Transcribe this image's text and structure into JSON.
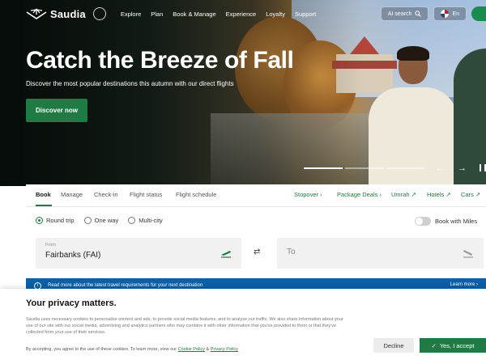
{
  "nav": {
    "logo_text": "Saudia",
    "menu": [
      "Explore",
      "Plan",
      "Book & Manage",
      "Experience",
      "Loyalty",
      "Support"
    ],
    "search_label": "AI search",
    "language": "En"
  },
  "hero": {
    "title": "Catch the Breeze of Fall",
    "subtitle": "Discover the most popular destinations this autumn with our direct flights",
    "cta": "Discover now",
    "slide_count": 3,
    "active_slide": 1
  },
  "booking": {
    "tabs": [
      "Book",
      "Manage",
      "Check-in",
      "Flight status",
      "Flight schedule"
    ],
    "active_tab": "Book",
    "quick_links": [
      "Stopover",
      "Package Deals",
      "Umrah",
      "Hotels",
      "Cars"
    ],
    "trip_types": [
      "Round trip",
      "One way",
      "Multi-city"
    ],
    "selected_trip_type": "Round trip",
    "miles_label": "Book with Miles",
    "from_label": "From",
    "from_value": "Fairbanks (FAI)",
    "to_placeholder": "To"
  },
  "info_bar": {
    "text": "Read more about the latest travel requirements for your next destination",
    "link": "Learn more"
  },
  "cookie": {
    "title": "Your privacy matters.",
    "body": "Saudia uses necessary cookies to personalise content and ads, to provide social media features, and to analyse our traffic. We also share information about your use of our site with our social media, advertising and analytics partners who may combine it with other information that you've provided to them or that they've collected from your use of their services.",
    "consent_prefix": "By accepting, you agree to the use of these cookies. To learn more, view our",
    "cookie_policy": "Cookie Policy",
    "amp": "&",
    "privacy_policy": "Privacy Policy",
    "decline": "Decline",
    "accept": "Yes, I accept"
  },
  "colors": {
    "brand_green": "#1f7a44",
    "info_blue": "#0d5fa6"
  }
}
